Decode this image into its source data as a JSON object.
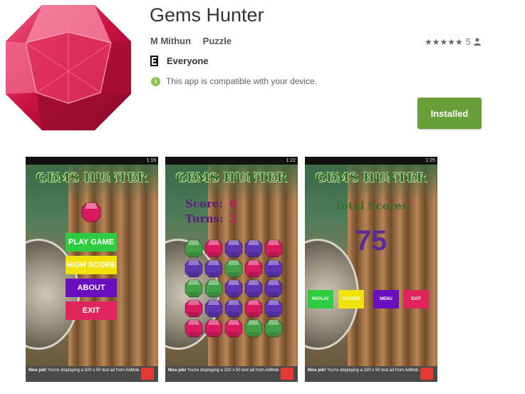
{
  "app": {
    "title": "Gems Hunter",
    "developer": "M Mithun",
    "category": "Puzzle",
    "rating_stars": "★★★★★",
    "rating_count": "5",
    "content_rating": "Everyone",
    "compatibility": "This app is compatible with your device.",
    "install_label": "Installed"
  },
  "colors": {
    "install_button": "#689f38",
    "info_icon": "#8bc34a",
    "gem_red": "#d81b60",
    "gem_green": "#43a047",
    "gem_purple": "#5e35b1"
  },
  "screenshots": [
    {
      "time": "1:19",
      "game_title": "GEMS HUNTER",
      "menu": [
        {
          "label": "PLAY GAME",
          "color": "#2ecc40"
        },
        {
          "label": "HIGH SCORE",
          "color": "#f1e20b"
        },
        {
          "label": "ABOUT",
          "color": "#6a0fbf"
        },
        {
          "label": "EXIT",
          "color": "#e0245e"
        }
      ],
      "ad_title": "Nice job!",
      "ad_text": "You're displaying a 320 x 50 test ad from AdMob."
    },
    {
      "time": "1:22",
      "game_title": "GEMS HUNTER",
      "score_label": "Score:",
      "score_value": "0",
      "turns_label": "Turns:",
      "turns_value": "2",
      "grid": [
        [
          "green",
          "red",
          "purple",
          "purple",
          "red"
        ],
        [
          "purple",
          "purple",
          "green",
          "red",
          "purple"
        ],
        [
          "green",
          "green",
          "purple",
          "purple",
          "purple"
        ],
        [
          "red",
          "purple",
          "purple",
          "red",
          "purple"
        ],
        [
          "red",
          "red",
          "red",
          "green",
          "green"
        ]
      ],
      "ad_title": "Nice job!",
      "ad_text": "You're displaying a 320 x 50 test ad from AdMob."
    },
    {
      "time": "1:25",
      "game_title": "GEMS HUNTER",
      "total_label": "Total Scores",
      "total_value": "75",
      "buttons": [
        {
          "label": "REPLAY",
          "color": "#2ecc40"
        },
        {
          "label": "SCORES",
          "color": "#f1e20b"
        },
        {
          "label": "MENU",
          "color": "#6a0fbf"
        },
        {
          "label": "EXIT",
          "color": "#e0245e"
        }
      ],
      "ad_title": "Nice job!",
      "ad_text": "You're displaying a 320 x 50 test ad from AdMob."
    }
  ]
}
